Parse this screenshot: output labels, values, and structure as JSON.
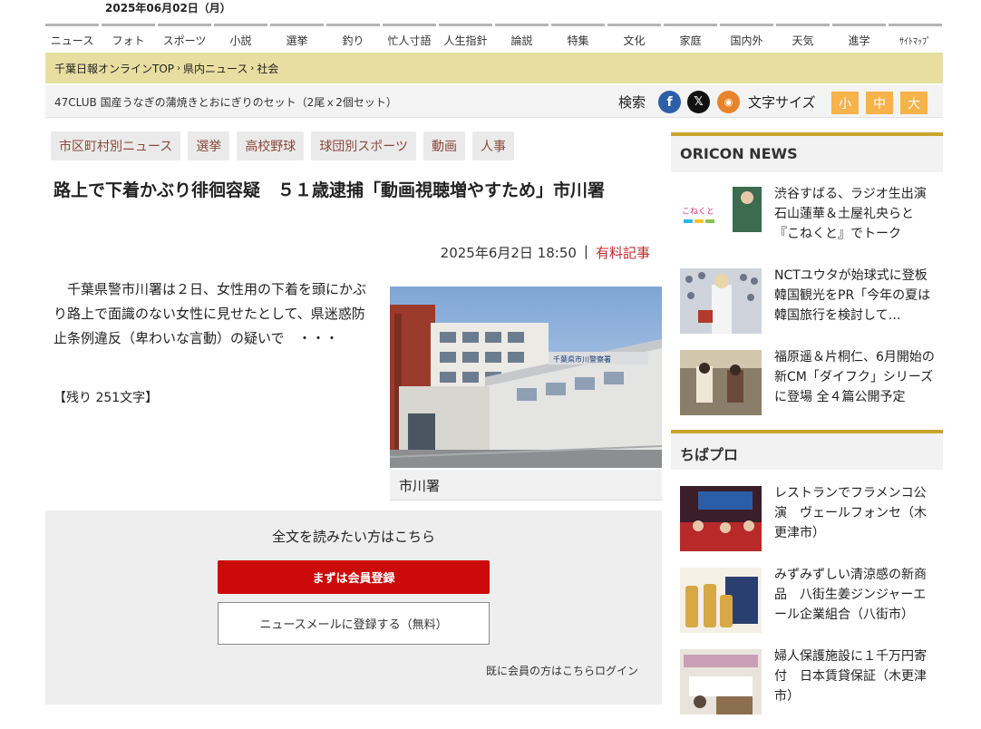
{
  "header": {
    "date": "2025年06月02日（月）"
  },
  "global_nav": [
    {
      "label": "ニュース",
      "w": 59
    },
    {
      "label": "フォト",
      "w": 59
    },
    {
      "label": "スポーツ",
      "w": 59
    },
    {
      "label": "小説",
      "w": 59
    },
    {
      "label": "選挙",
      "w": 59
    },
    {
      "label": "釣り",
      "w": 59
    },
    {
      "label": "忙人寸語",
      "w": 59
    },
    {
      "label": "人生指針",
      "w": 59
    },
    {
      "label": "論説",
      "w": 59
    },
    {
      "label": "特集",
      "w": 59
    },
    {
      "label": "文化",
      "w": 59
    },
    {
      "label": "家庭",
      "w": 59
    },
    {
      "label": "国内外",
      "w": 59
    },
    {
      "label": "天気",
      "w": 59
    },
    {
      "label": "進学",
      "w": 59
    },
    {
      "label": "ｻｲﾄﾏｯﾌﾟ",
      "w": 59
    }
  ],
  "breadcrumb": [
    "千葉日報オンラインTOP",
    "県内ニュース",
    "社会"
  ],
  "breadcrumb_sep": "›",
  "info_bar": {
    "promo": "47CLUB 国産うなぎの蒲焼きとおにぎりのセット（2尾ｘ2個セット）",
    "search_label": "検索",
    "fb": "f",
    "x": "𝕏",
    "rss": "◉",
    "font_size_label": "文字サイズ",
    "font_small": "小",
    "font_medium": "中",
    "font_large": "大"
  },
  "tags": [
    "市区町村別ニュース",
    "選挙",
    "高校野球",
    "球団別スポーツ",
    "動画",
    "人事"
  ],
  "article": {
    "headline": "路上で下着かぶり徘徊容疑　５１歳逮捕「動画視聴増やすため」市川署",
    "date": "2025年6月2日 18:50",
    "meta_sep": "|",
    "paid_label": "有料記事",
    "body": "　千葉県警市川署は２日、女性用の下着を頭にかぶり路上で面識のない女性に見せたとして、県迷惑防止条例違反（卑わいな言動）の疑いで　・・・",
    "remaining": "【残り 251文字】",
    "photo_caption": "市川署",
    "photo_sign": "千葉県市川警察署"
  },
  "paywall": {
    "title": "全文を読みたい方はこちら",
    "register_button": "まずは会員登録",
    "newsletter_button": "ニュースメールに登録する（無料）",
    "login_link": "既に会員の方はこちらログイン"
  },
  "sidebar": {
    "oricon_title": "ORICON NEWS",
    "oricon_items": [
      {
        "text": "渋谷すばる、ラジオ生出演　石山蓮華＆土屋礼央らと『こねくと』でトーク",
        "thumb": "こねくと"
      },
      {
        "text": "NCTユウタが始球式に登板　韓国観光をPR「今年の夏は韓国旅行を検討して…"
      },
      {
        "text": "福原遥＆片桐仁、6月開始の新CM「ダイフク」シリーズに登場 全４篇公開予定"
      }
    ],
    "chibapro_title": "ちばプロ",
    "chibapro_items": [
      {
        "text": "レストランでフラメンコ公演　ヴェールフォンセ（木更津市）"
      },
      {
        "text": "みずみずしい清涼感の新商品　八街生姜ジンジャーエール企業組合（八街市）"
      },
      {
        "text": "婦人保護施設に１千万円寄付　日本賃貸保証（木更津市）"
      }
    ]
  },
  "colors": {
    "accent_gold": "#c9a52c",
    "breadcrumb_bg": "#e9dea1",
    "register_red": "#cc0a0a",
    "font_btn": "#f7b24a",
    "tag_text": "#8a4a3c"
  }
}
